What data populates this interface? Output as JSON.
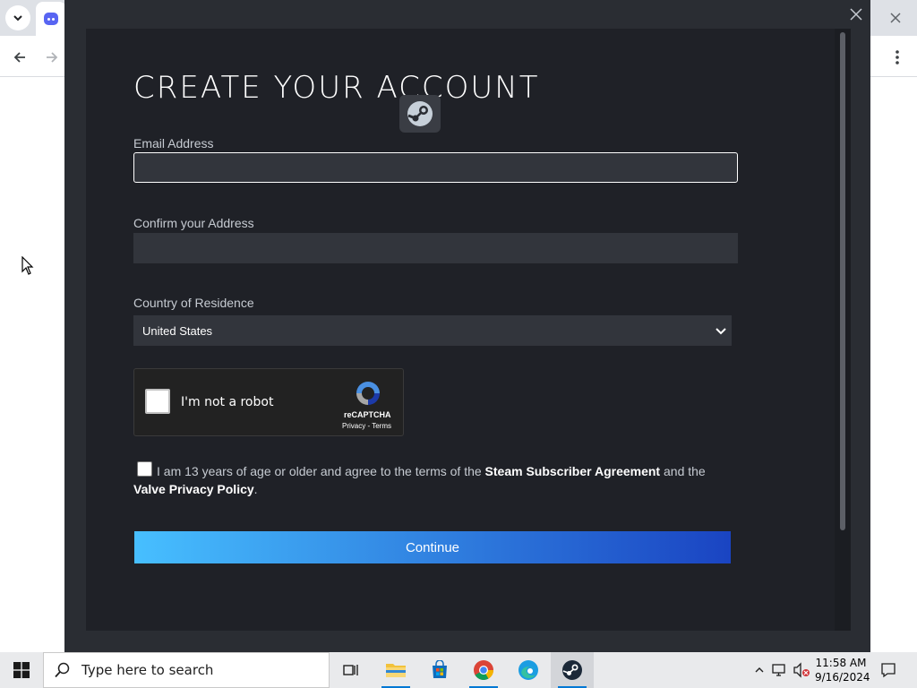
{
  "colors": {
    "modal_bg": "#2a2d33",
    "panel_bg": "#1f2127",
    "field_bg": "#32353c",
    "button_gradient_start": "#47bfff",
    "button_gradient_end": "#1a44c2",
    "taskbar_bg": "#e9eaec"
  },
  "browser": {
    "icons": [
      "chevron-down-icon",
      "discord-icon",
      "back-arrow-icon",
      "forward-arrow-icon",
      "close-icon",
      "kebab-menu-icon"
    ]
  },
  "dialog": {
    "title": "CREATE YOUR ACCOUNT",
    "email": {
      "label": "Email Address",
      "value": "",
      "placeholder": ""
    },
    "confirm_email": {
      "label": "Confirm your Address",
      "value": "",
      "placeholder": ""
    },
    "country": {
      "label": "Country of Residence",
      "selected": "United States"
    },
    "recaptcha": {
      "label": "I'm not a robot",
      "brand": "reCAPTCHA",
      "privacy": "Privacy",
      "separator": " - ",
      "terms": "Terms",
      "checked": false
    },
    "agreement": {
      "checked": false,
      "text_1": "I am 13 years of age or older and agree to the terms of the ",
      "link_1": "Steam Subscriber Agreement",
      "text_2": " and the ",
      "link_2": "Valve Privacy Policy",
      "text_3": "."
    },
    "continue_label": "Continue"
  },
  "taskbar": {
    "search_placeholder": "Type here to search",
    "apps": [
      "task-view-icon",
      "file-explorer-icon",
      "microsoft-store-icon",
      "chrome-icon",
      "edge-icon",
      "steam-icon"
    ],
    "active_app": "steam-icon",
    "time": "11:58 AM",
    "date": "9/16/2024"
  }
}
